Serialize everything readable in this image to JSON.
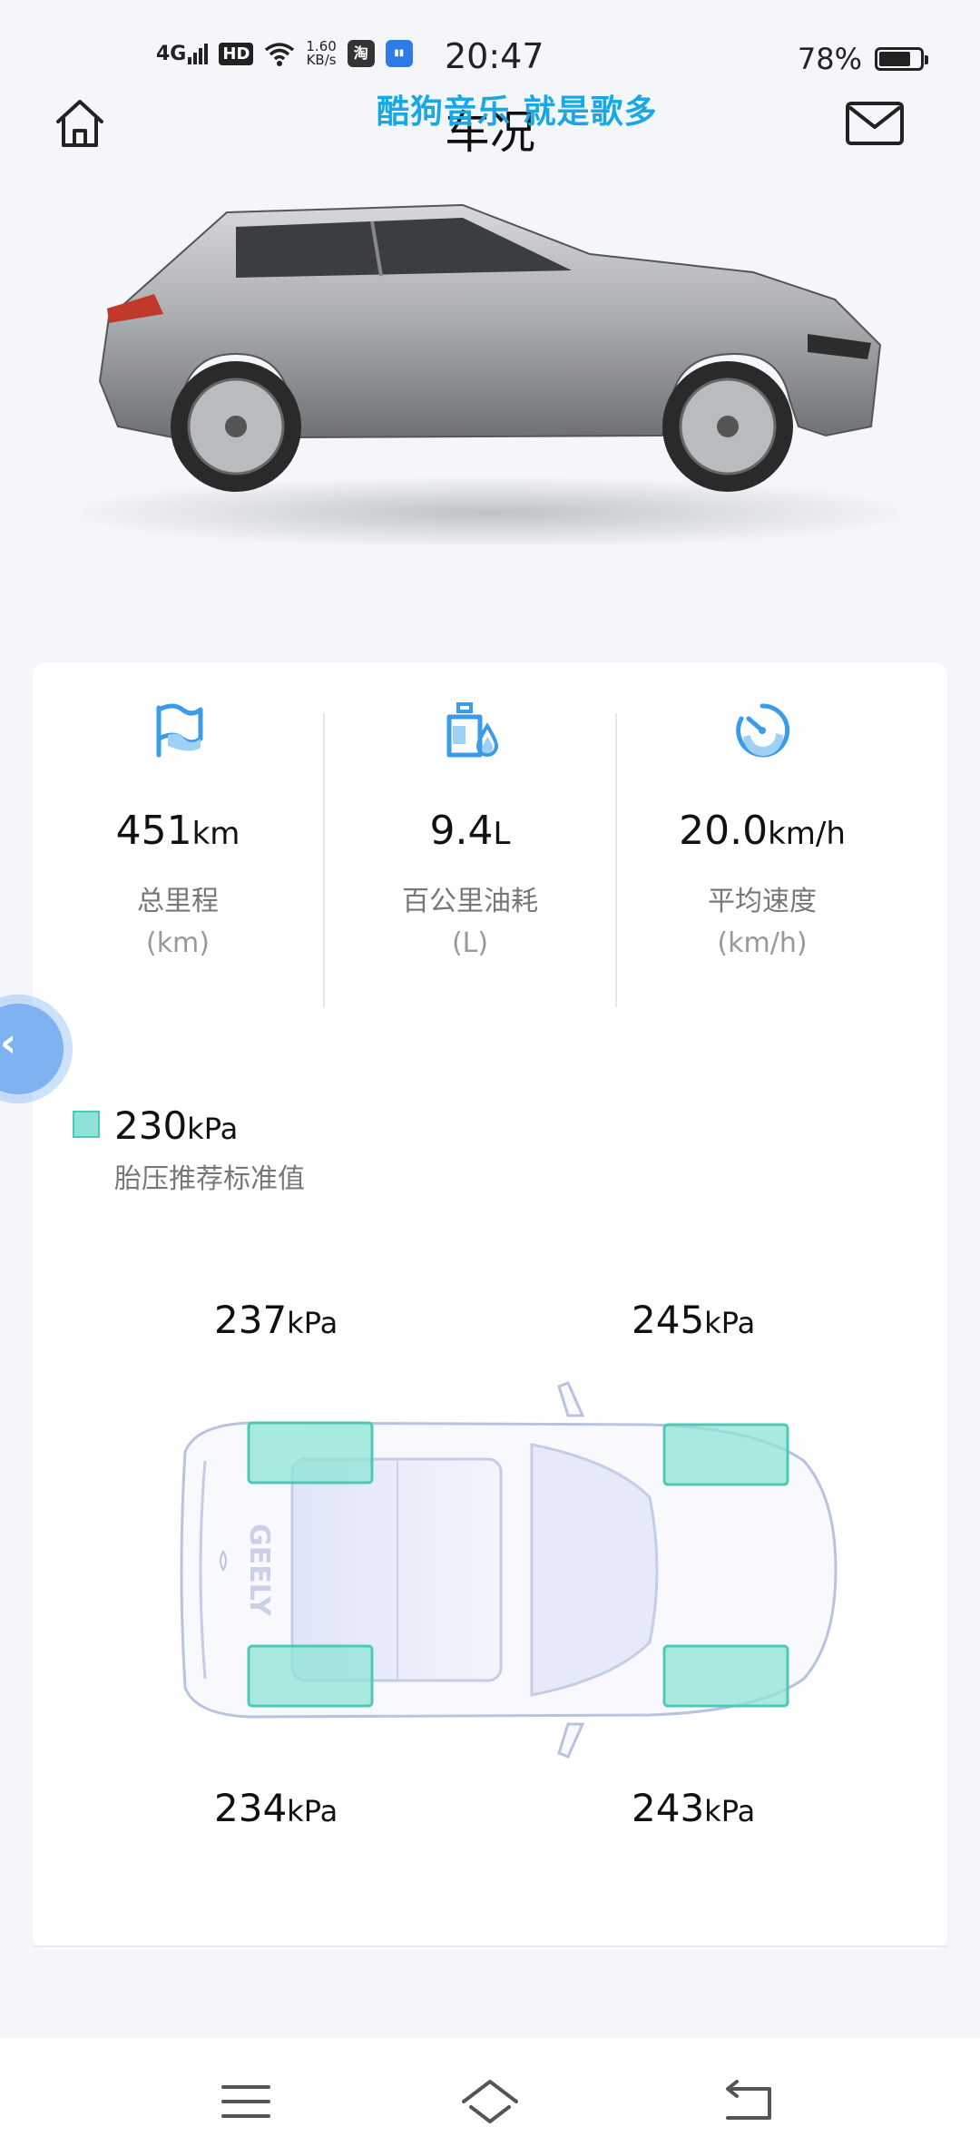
{
  "status_bar": {
    "network": "4G",
    "hd": "HD",
    "speed_value": "1.60",
    "speed_unit": "KB/s",
    "app1": "淘",
    "time": "20:47",
    "battery_percent": "78%",
    "battery_level": 0.78
  },
  "header": {
    "title": "车况",
    "overlay_lyric": "酷狗音乐 就是歌多"
  },
  "stats": [
    {
      "value": "451",
      "unit": "km",
      "label": "总里程",
      "sub": "(km)",
      "icon": "flag-icon"
    },
    {
      "value": "9.4",
      "unit": "L",
      "label": "百公里油耗",
      "sub": "(L)",
      "icon": "fuel-drop-icon"
    },
    {
      "value": "20.0",
      "unit": "km/h",
      "label": "平均速度",
      "sub": "(km/h)",
      "icon": "speedometer-icon"
    }
  ],
  "tire_legend": {
    "value": "230",
    "unit": "kPa",
    "label": "胎压推荐标准值"
  },
  "tires": {
    "front_left": {
      "value": "237",
      "unit": "kPa"
    },
    "front_right": {
      "value": "245",
      "unit": "kPa"
    },
    "rear_left": {
      "value": "234",
      "unit": "kPa"
    },
    "rear_right": {
      "value": "243",
      "unit": "kPa"
    }
  },
  "car_brand_mark": "GEELY",
  "colors": {
    "accent_blue": "#3b9be8",
    "tire_fill": "#8ee3d6",
    "lyric_blue": "#18a8e8"
  }
}
